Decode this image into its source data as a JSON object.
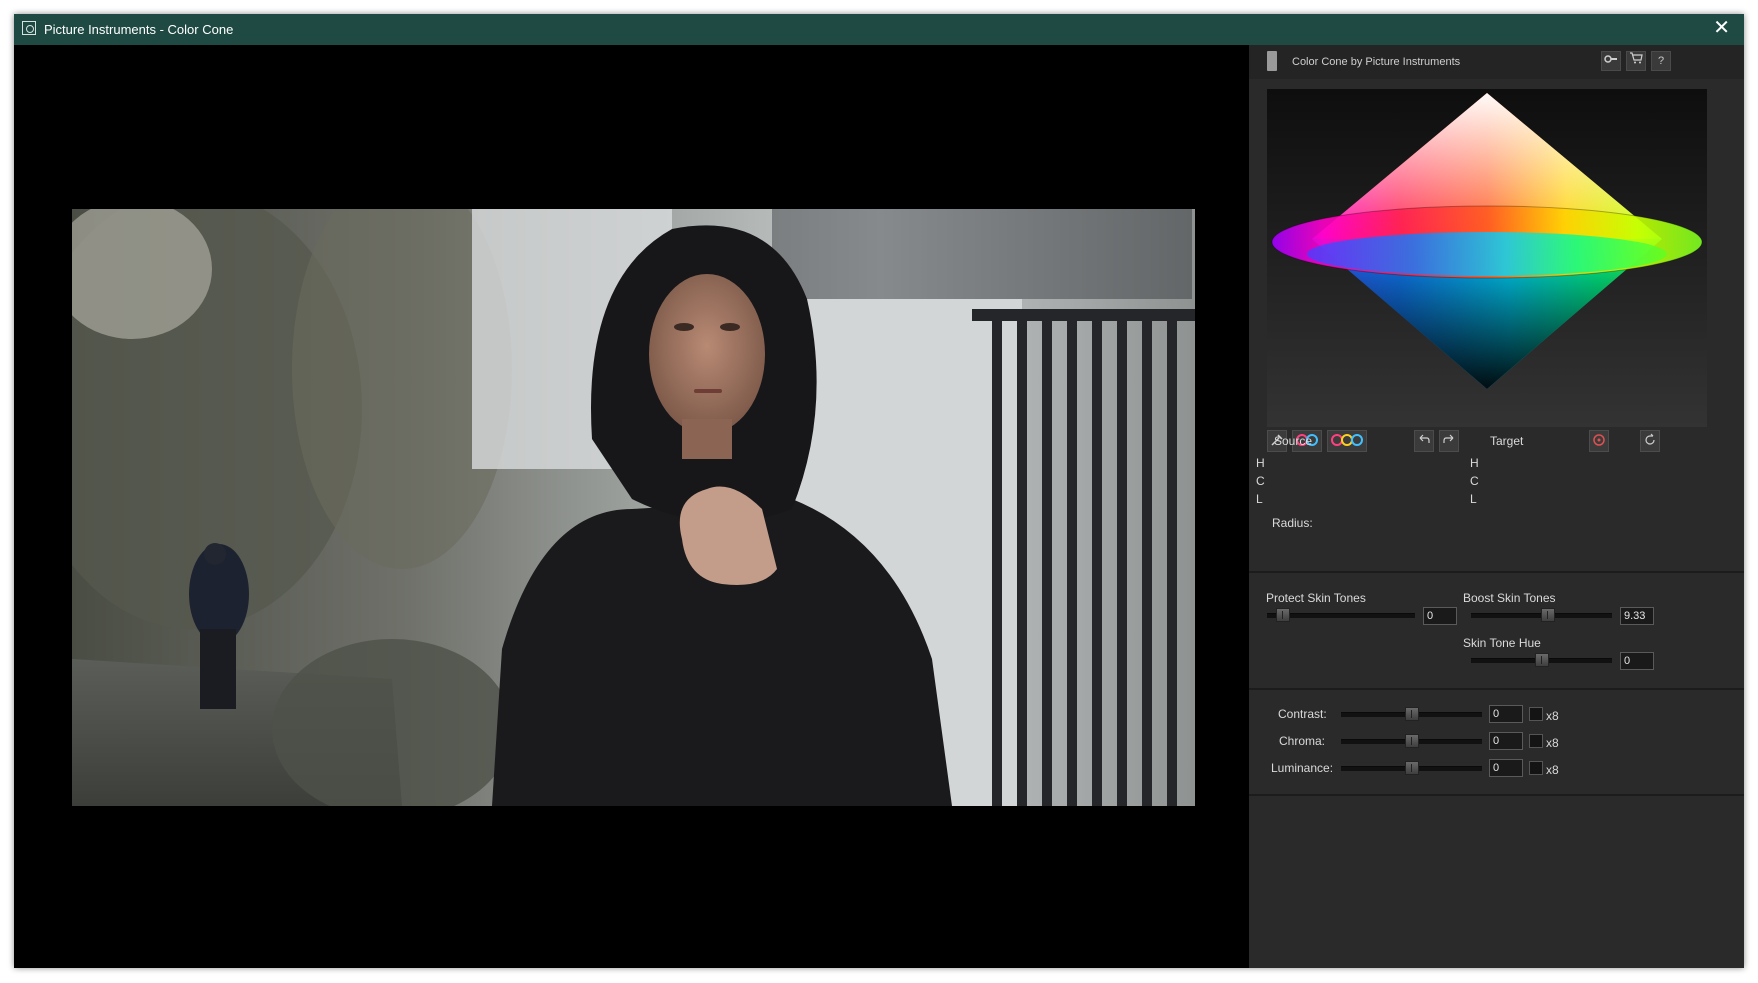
{
  "window": {
    "title": "Picture Instruments - Color Cone",
    "close_glyph": "✕"
  },
  "panel": {
    "header_title": "Color Cone by Picture Instruments",
    "header_buttons": {
      "key": "key-icon",
      "cart": "cart-icon",
      "help": "?"
    },
    "toolbar": [
      "eyedropper-icon",
      "two-circles-icon",
      "three-circles-icon",
      "undo-icon",
      "redo-icon",
      "target-icon",
      "reset-icon"
    ],
    "source": {
      "label": "Source",
      "h": "H",
      "c": "C",
      "l": "L"
    },
    "target": {
      "label": "Target",
      "h": "H",
      "c": "C",
      "l": "L"
    },
    "radius_label": "Radius:",
    "skin": {
      "protect": {
        "label": "Protect Skin Tones",
        "value": "0",
        "level": 0.07
      },
      "boost": {
        "label": "Boost Skin Tones",
        "value": "9.33",
        "level": 0.55
      },
      "hue": {
        "label": "Skin Tone Hue",
        "value": "0",
        "level": 0.5
      }
    },
    "adjust": {
      "contrast": {
        "label": "Contrast:",
        "value": "0",
        "x8": "x8",
        "level": 0.5
      },
      "chroma": {
        "label": "Chroma:",
        "value": "0",
        "x8": "x8",
        "level": 0.5
      },
      "luminance": {
        "label": "Luminance:",
        "value": "0",
        "x8": "x8",
        "level": 0.5
      }
    }
  }
}
